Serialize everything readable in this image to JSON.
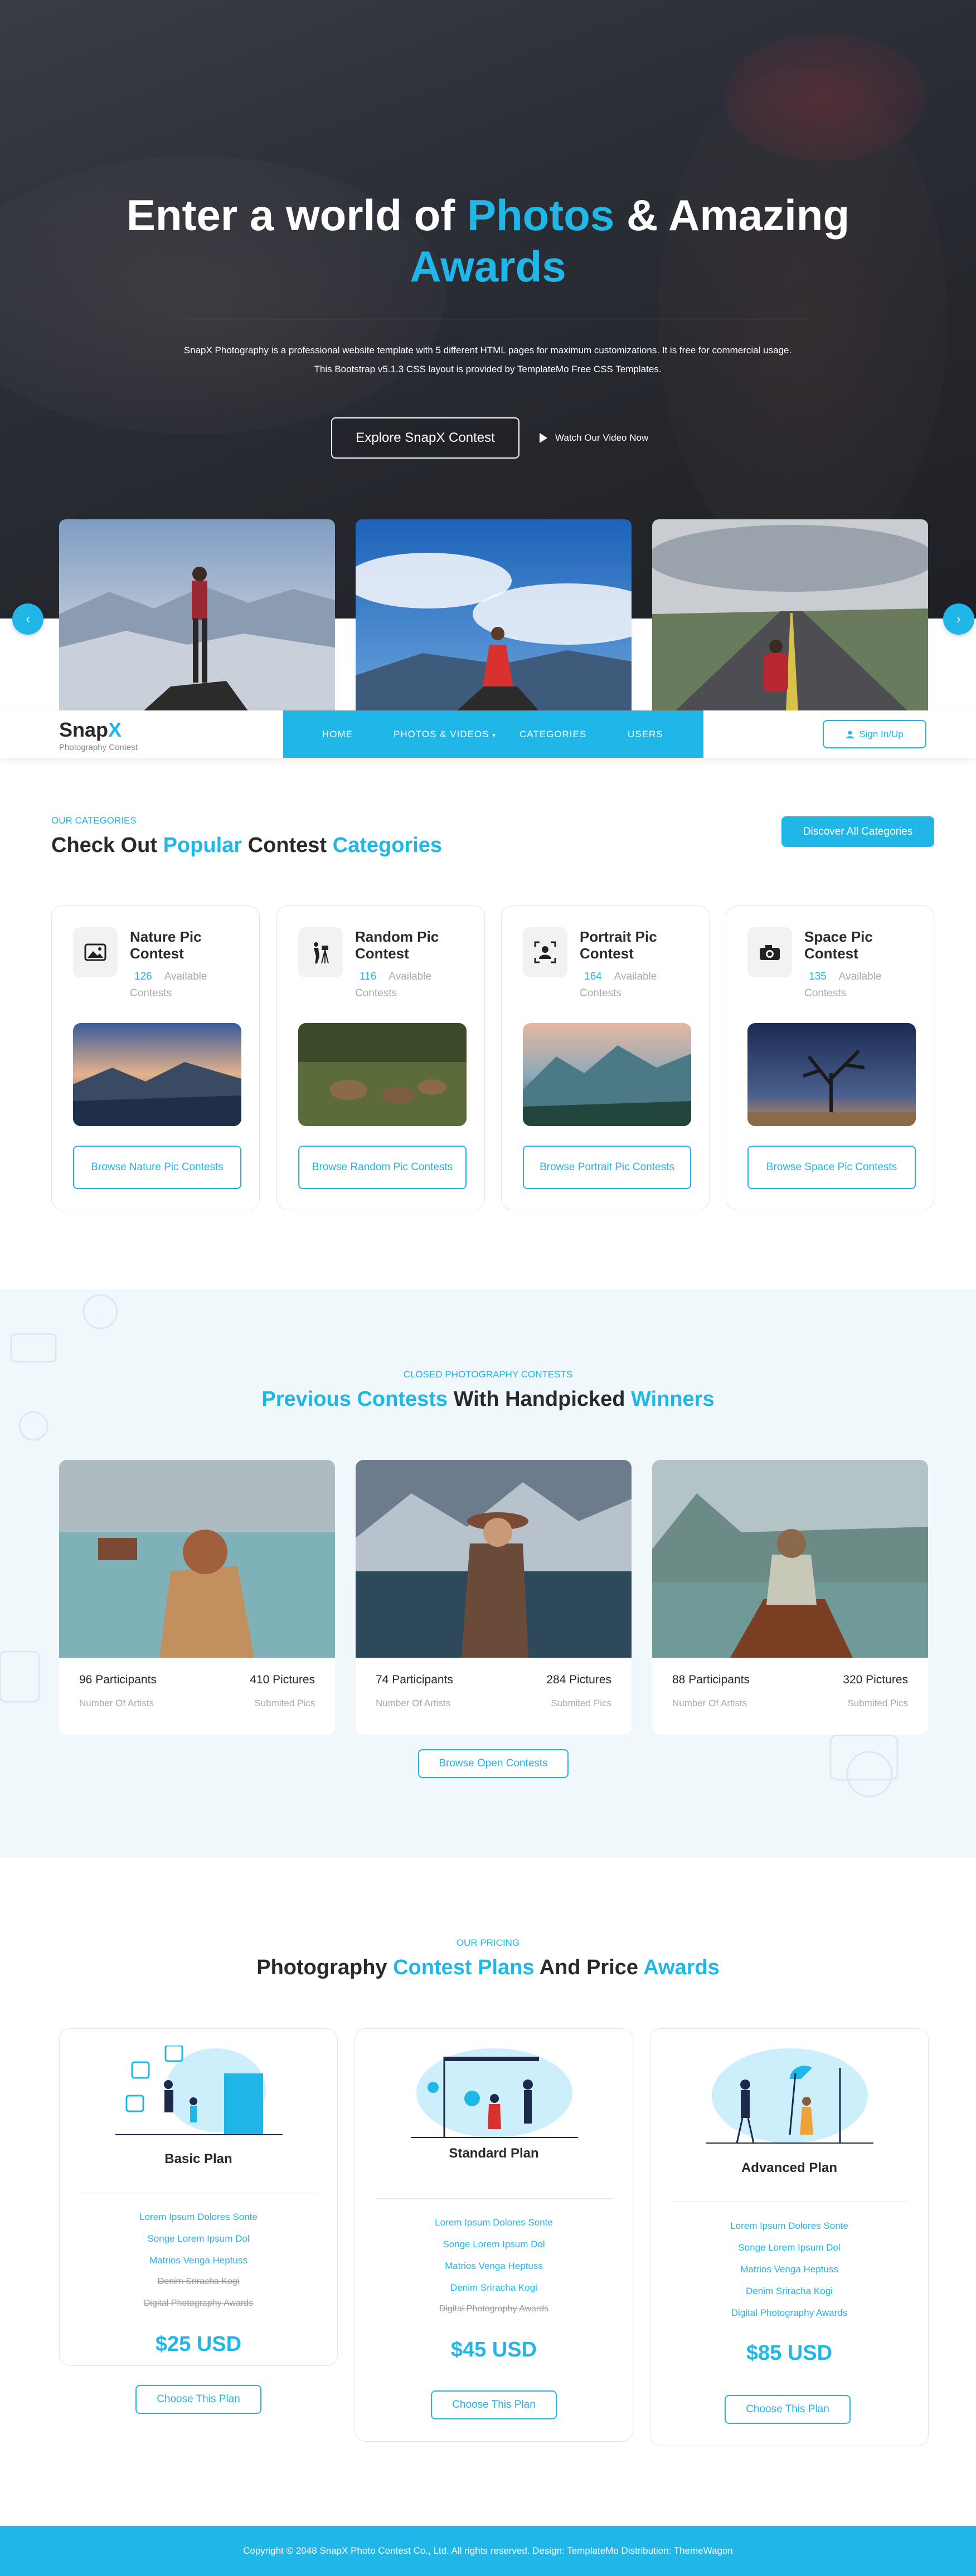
{
  "colors": {
    "accent": "#21b6e8",
    "text": "#2a2a2a",
    "muted": "#aaaaaa"
  },
  "hero": {
    "title_part1": "Enter a world of ",
    "title_accent1": "Photos",
    "title_part2": " & Amazing",
    "title_accent2": "Awards",
    "description": "SnapX Photography is a professional website template with 5 different HTML pages for maximum customizations. It is free for commercial usage. This Bootstrap v5.1.3 CSS layout is provided by TemplateMo Free CSS Templates.",
    "explore_button": "Explore SnapX Contest",
    "watch_link": "Watch Our Video Now",
    "prev_icon": "chevron-left-icon",
    "next_icon": "chevron-right-icon"
  },
  "nav": {
    "logo_main": "Snap",
    "logo_accent": "X",
    "logo_sub": "Photography Contest",
    "items": [
      {
        "label": "HOME"
      },
      {
        "label": "PHOTOS & VIDEOS"
      },
      {
        "label": "CATEGORIES"
      },
      {
        "label": "USERS"
      }
    ],
    "signin": "Sign In/Up"
  },
  "categories": {
    "tag": "OUR CATEGORIES",
    "h_part1": "Check Out ",
    "h_accent1": "Popular",
    "h_part2": " Contest ",
    "h_accent2": "Categories",
    "discover_button": "Discover All Categories",
    "available_label": "Available Contests",
    "cards": [
      {
        "title": "Nature Pic Contest",
        "count": "126",
        "button": "Browse Nature Pic Contests",
        "icon": "landscape-photo-icon"
      },
      {
        "title": "Random Pic Contest",
        "count": "116",
        "button": "Browse Random Pic Contests",
        "icon": "photographer-tripod-icon"
      },
      {
        "title": "Portrait Pic Contest",
        "count": "164",
        "button": "Browse Portrait Pic Contests",
        "icon": "portrait-frame-icon"
      },
      {
        "title": "Space Pic Contest",
        "count": "135",
        "button": "Browse Space Pic Contests",
        "icon": "camera-icon"
      }
    ]
  },
  "contests": {
    "tag": "CLOSED PHOTOGRAPHY CONTESTS",
    "h_accent1": "Previous Contests",
    "h_part": " With Handpicked ",
    "h_accent2": "Winners",
    "participants_sub": "Number Of Artists",
    "pictures_sub": "Submited Pics",
    "cards": [
      {
        "participants": "96 Participants",
        "pictures": "410 Pictures"
      },
      {
        "participants": "74 Participants",
        "pictures": "284 Pictures"
      },
      {
        "participants": "88 Participants",
        "pictures": "320 Pictures"
      }
    ],
    "browse_button": "Browse Open Contests"
  },
  "pricing": {
    "tag": "OUR PRICING",
    "h_part1": "Photography ",
    "h_accent1": "Contest Plans",
    "h_part2": " And Price ",
    "h_accent2": "Awards",
    "plans": [
      {
        "name": "Basic Plan",
        "price": "$25 USD",
        "button": "Choose This Plan",
        "features": [
          "Lorem Ipsum Dolores Sonte",
          "Songe Lorem Ipsum Dol",
          "Matrios Venga Heptuss",
          "Denim Sriracha Kogi",
          "Digital Photography Awards"
        ],
        "enabled": [
          true,
          true,
          true,
          false,
          false
        ]
      },
      {
        "name": "Standard Plan",
        "price": "$45 USD",
        "button": "Choose This Plan",
        "features": [
          "Lorem Ipsum Dolores Sonte",
          "Songe Lorem Ipsum Dol",
          "Matrios Venga Heptuss",
          "Denim Sriracha Kogi",
          "Digital Photography Awards"
        ],
        "enabled": [
          true,
          true,
          true,
          true,
          false
        ]
      },
      {
        "name": "Advanced Plan",
        "price": "$85 USD",
        "button": "Choose This Plan",
        "features": [
          "Lorem Ipsum Dolores Sonte",
          "Songe Lorem Ipsum Dol",
          "Matrios Venga Heptuss",
          "Denim Sriracha Kogi",
          "Digital Photography Awards"
        ],
        "enabled": [
          true,
          true,
          true,
          true,
          true
        ]
      }
    ]
  },
  "footer": {
    "copyright": "Copyright © 2048 SnapX Photo Contest Co., Ltd. All rights reserved. Design: TemplateMo Distribution: ThemeWagon"
  }
}
